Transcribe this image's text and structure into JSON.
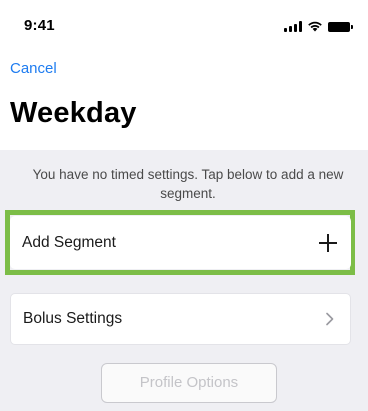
{
  "status_bar": {
    "time": "9:41",
    "icons": [
      "signal-icon",
      "wifi-icon",
      "battery-icon"
    ]
  },
  "nav": {
    "cancel_label": "Cancel"
  },
  "page": {
    "title": "Weekday"
  },
  "info": {
    "message": "You have no timed settings. Tap below to add a new segment."
  },
  "rows": {
    "add_segment_label": "Add Segment",
    "add_segment_icon": "plus-icon",
    "bolus_settings_label": "Bolus Settings",
    "bolus_settings_icon": "chevron-right-icon"
  },
  "buttons": {
    "profile_options_label": "Profile Options",
    "profile_options_disabled": true
  },
  "colors": {
    "accent_link": "#1e7cf0",
    "highlight_frame": "#7cbd47",
    "content_background": "#efeff3"
  }
}
